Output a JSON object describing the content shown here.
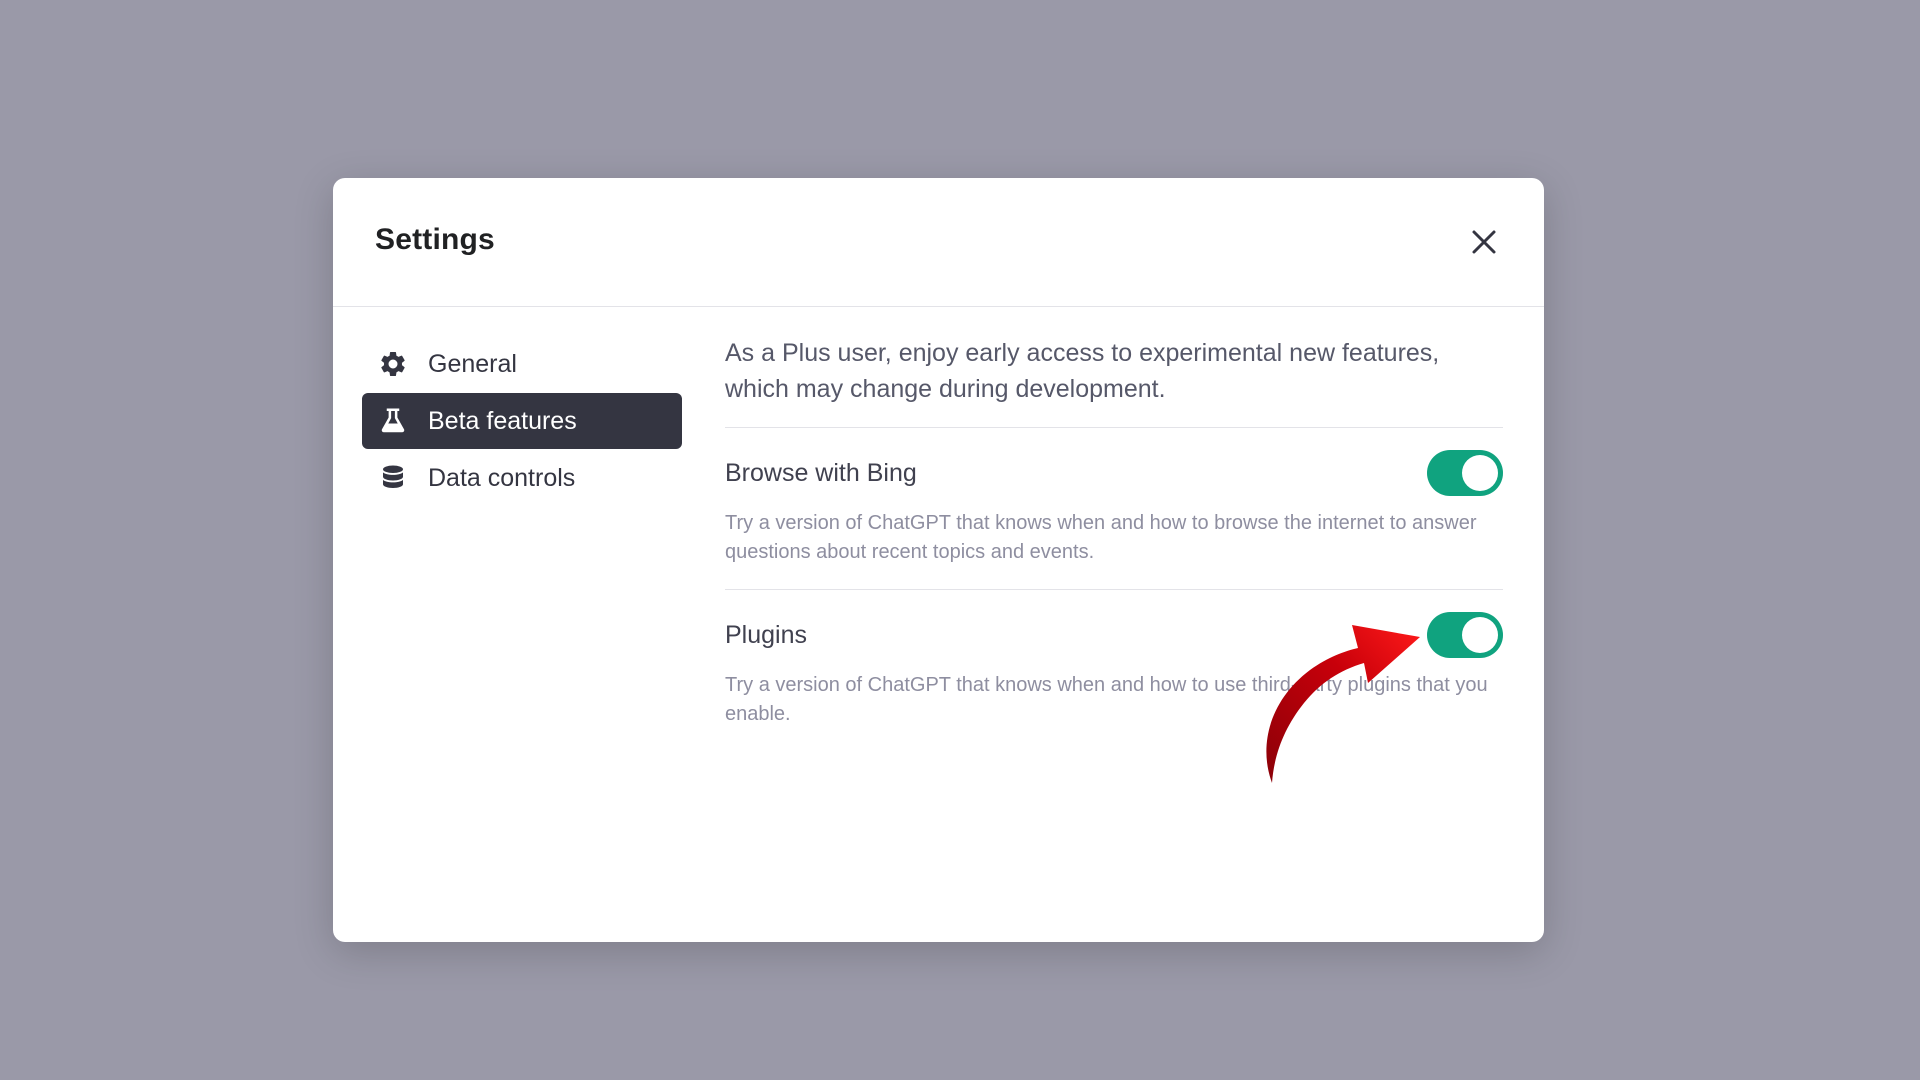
{
  "modal": {
    "title": "Settings"
  },
  "sidebar": {
    "items": [
      {
        "label": "General",
        "icon": "gear-icon",
        "active": false
      },
      {
        "label": "Beta features",
        "icon": "flask-icon",
        "active": true
      },
      {
        "label": "Data controls",
        "icon": "database-icon",
        "active": false
      }
    ]
  },
  "content": {
    "intro": "As a Plus user, enjoy early access to experimental new features, which may change during development.",
    "features": [
      {
        "title": "Browse with Bing",
        "description": "Try a version of ChatGPT that knows when and how to browse the internet to answer questions about recent topics and events.",
        "enabled": true
      },
      {
        "title": "Plugins",
        "description": "Try a version of ChatGPT that knows when and how to use third-party plugins that you enable.",
        "enabled": true
      }
    ]
  },
  "colors": {
    "backdrop": "#9a99a8",
    "toggle_on": "#10a37f",
    "active_nav": "#343541",
    "annotation_arrow": "#c8000a"
  }
}
